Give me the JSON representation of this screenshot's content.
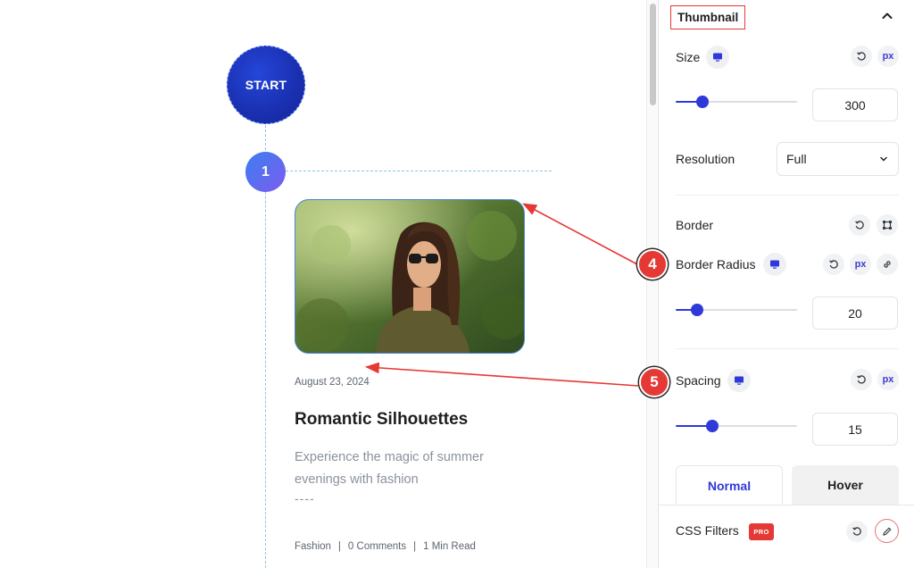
{
  "canvas": {
    "start_label": "START",
    "step_number": "1",
    "post": {
      "date": "August 23, 2024",
      "title": "Romantic Silhouettes",
      "excerpt": "Experience the magic of summer evenings with fashion",
      "more": "----",
      "meta": {
        "category": "Fashion",
        "comments": "0 Comments",
        "read_time": "1 Min Read",
        "separator": "|"
      }
    }
  },
  "panel": {
    "section_title": "Thumbnail",
    "size": {
      "label": "Size",
      "unit": "px",
      "value": "300",
      "slider_fraction": 0.22
    },
    "resolution": {
      "label": "Resolution",
      "selected": "Full"
    },
    "border": {
      "label": "Border"
    },
    "border_radius": {
      "label": "Border Radius",
      "unit": "px",
      "value": "20",
      "slider_fraction": 0.18
    },
    "spacing": {
      "label": "Spacing",
      "unit": "px",
      "value": "15",
      "slider_fraction": 0.3
    },
    "tabs": {
      "normal": "Normal",
      "hover": "Hover"
    },
    "css_filters": {
      "label": "CSS Filters",
      "badge": "PRO"
    }
  },
  "annotations": {
    "marker_4": "4",
    "marker_5": "5"
  },
  "colors": {
    "accent": "#2f38d8",
    "annotation_red": "#e53935",
    "start_blue": "#1a2fb0"
  }
}
